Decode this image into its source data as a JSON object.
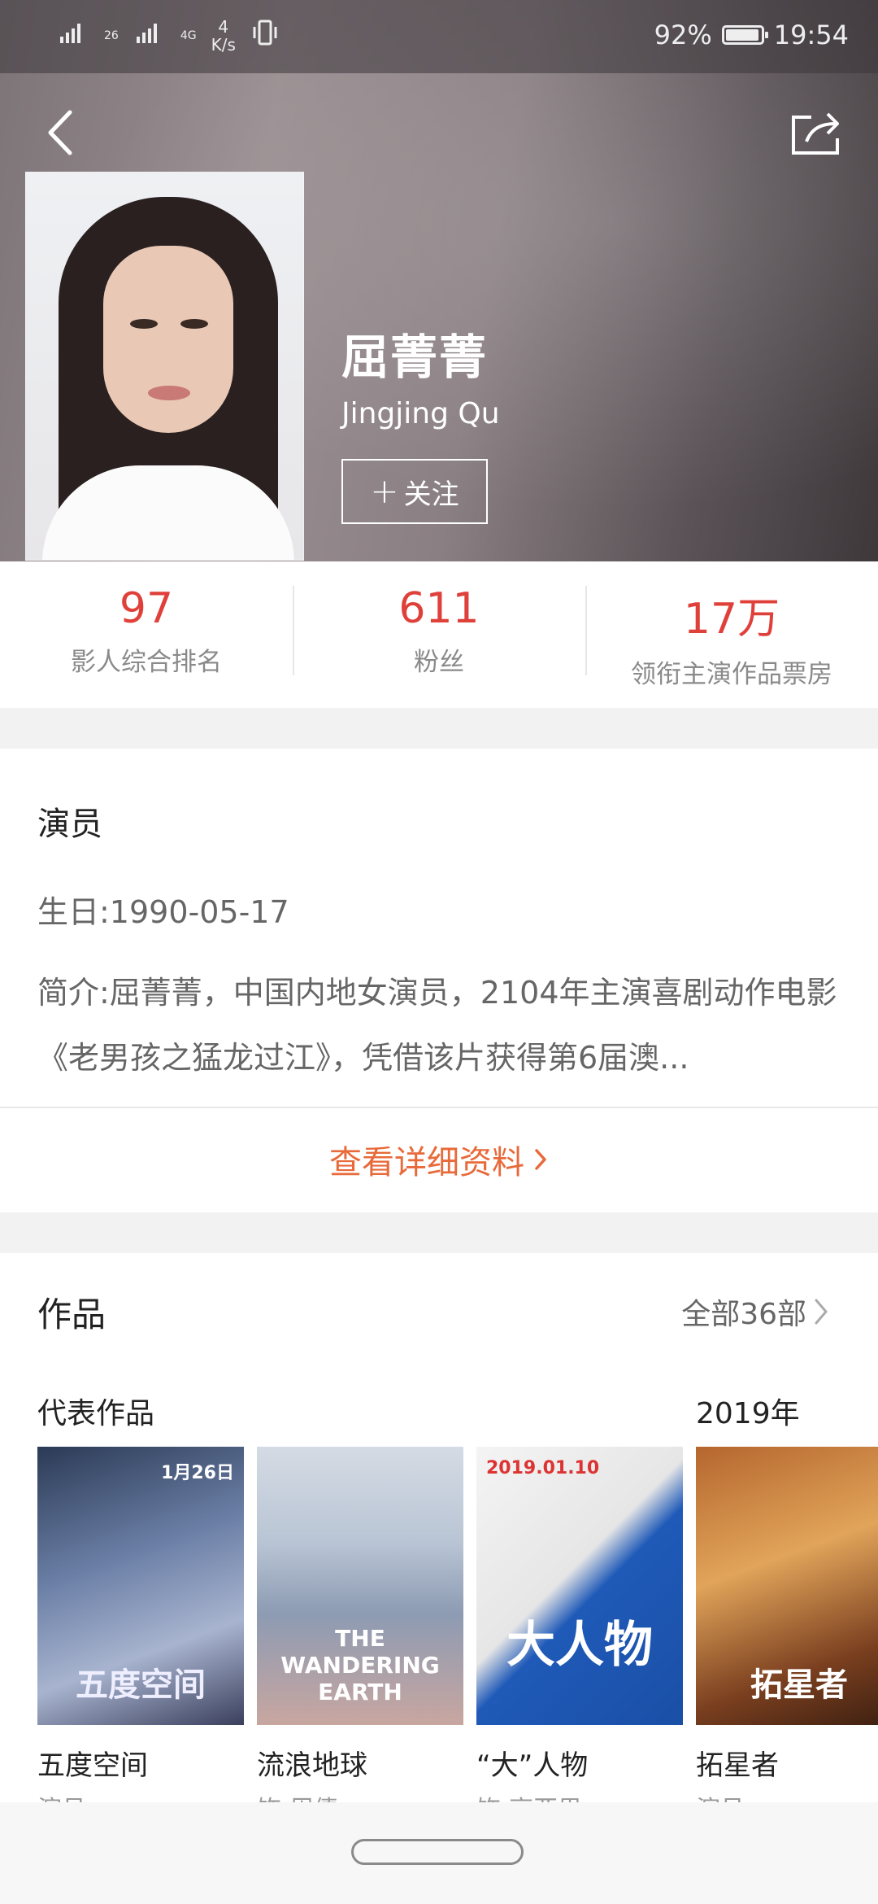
{
  "status_bar": {
    "signal1": "26",
    "signal2": "4G",
    "speed_value": "4",
    "speed_unit": "K/s",
    "battery": "92%",
    "time": "19:54"
  },
  "header": {
    "back_icon": "chevron-left-icon",
    "share_icon": "share-icon",
    "name": "屈菁菁",
    "english_name": "Jingjing Qu",
    "follow_label": "关注"
  },
  "stats": [
    {
      "value": "97",
      "label": "影人综合排名"
    },
    {
      "value": "611",
      "label": "粉丝"
    },
    {
      "value": "17万",
      "label": "领衔主演作品票房"
    }
  ],
  "profile": {
    "role": "演员",
    "birthday": "生日:1990-05-17",
    "bio": "简介:屈菁菁，中国内地女演员，2104年主演喜剧动作电影《老男孩之猛龙过江》，凭借该片获得第6届澳...",
    "more_label": "查看详细资料"
  },
  "works": {
    "title": "作品",
    "all_label": "全部36部",
    "representative_label": "代表作品",
    "year_label": "2019年",
    "films": [
      {
        "title": "五度空间",
        "role": "演员",
        "poster_text": "五度空间",
        "poster_date": "1月26日"
      },
      {
        "title": "流浪地球",
        "role": "饰:周倩",
        "poster_text": "THE WANDERING EARTH",
        "poster_date": ""
      },
      {
        "title": "“大”人物",
        "role": "饰:高亚男",
        "poster_text": "大人物",
        "poster_date": "2019.01.10"
      },
      {
        "title": "拓星者",
        "role": "演员",
        "poster_text": "拓星者",
        "poster_date": ""
      }
    ]
  },
  "colors": {
    "accent_red": "#e0403a",
    "link_orange": "#e86a3a"
  }
}
